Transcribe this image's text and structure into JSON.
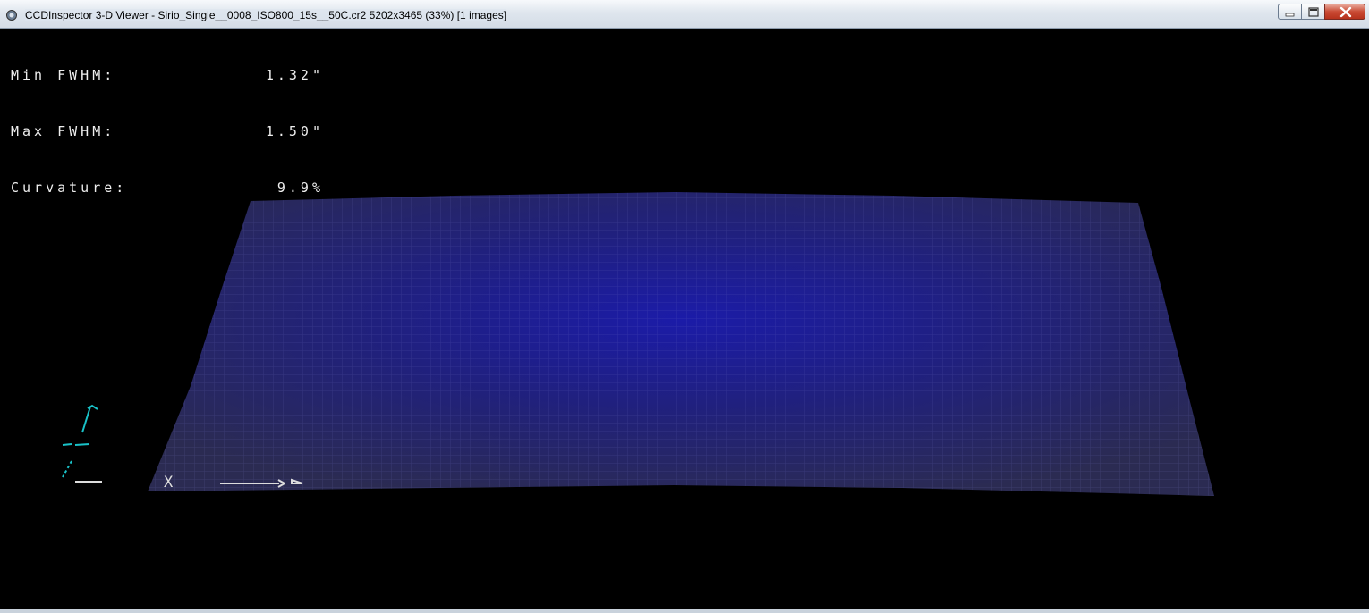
{
  "window": {
    "title": "CCDInspector 3-D Viewer - Sirio_Single__0008_ISO800_15s__50C.cr2 5202x3465 (33%)  [1 images]",
    "icon": "ccdinspector-app-icon",
    "controls": {
      "minimize": "minimize-icon",
      "maximize": "maximize-icon",
      "close": "close-icon"
    }
  },
  "stats": [
    {
      "label": "Min FWHM:",
      "value": "1.32\""
    },
    {
      "label": "Max FWHM:",
      "value": "1.50\""
    },
    {
      "label": "Curvature:",
      "value": "9.9%"
    }
  ],
  "axes": {
    "x_label": "X"
  },
  "colors": {
    "surface_center": "#1a1aa8",
    "surface_edge": "#2a2a55",
    "axis_color": "#19c2c8",
    "text_color": "#eeeeee",
    "background": "#000000"
  }
}
